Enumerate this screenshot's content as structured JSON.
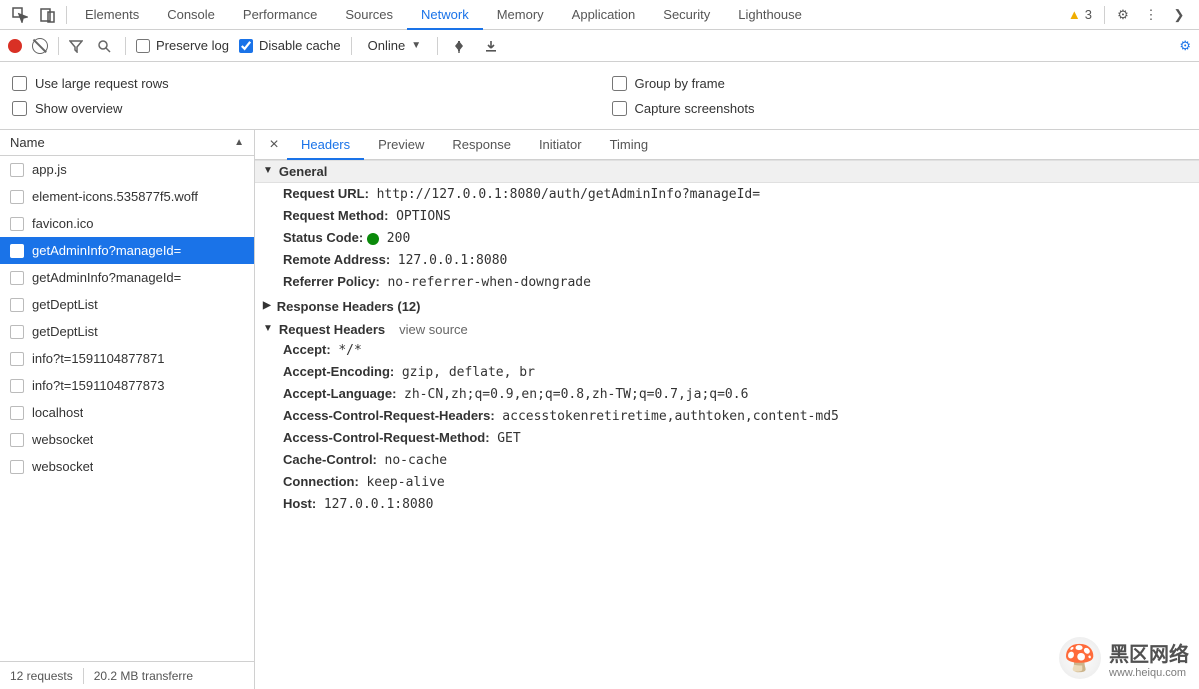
{
  "topTabs": {
    "items": [
      "Elements",
      "Console",
      "Performance",
      "Sources",
      "Network",
      "Memory",
      "Application",
      "Security",
      "Lighthouse"
    ],
    "active": "Network",
    "warnCount": "3"
  },
  "toolbar": {
    "preserveLog": "Preserve log",
    "disableCache": "Disable cache",
    "throttle": "Online"
  },
  "opts": {
    "largeRows": "Use large request rows",
    "overview": "Show overview",
    "groupFrame": "Group by frame",
    "capture": "Capture screenshots"
  },
  "side": {
    "header": "Name",
    "items": [
      "app.js",
      "element-icons.535877f5.woff",
      "favicon.ico",
      "getAdminInfo?manageId=",
      "getAdminInfo?manageId=",
      "getDeptList",
      "getDeptList",
      "info?t=1591104877871",
      "info?t=1591104877873",
      "localhost",
      "websocket",
      "websocket"
    ],
    "selectedIndex": 3,
    "footer": {
      "requests": "12 requests",
      "transferred": "20.2 MB transferre"
    }
  },
  "detail": {
    "tabs": [
      "Headers",
      "Preview",
      "Response",
      "Initiator",
      "Timing"
    ],
    "active": "Headers",
    "sections": {
      "general": {
        "title": "General",
        "rows": [
          {
            "k": "Request URL:",
            "v": "http://127.0.0.1:8080/auth/getAdminInfo?manageId="
          },
          {
            "k": "Request Method:",
            "v": "OPTIONS"
          },
          {
            "k": "Status Code:",
            "v": "200",
            "status": true
          },
          {
            "k": "Remote Address:",
            "v": "127.0.0.1:8080"
          },
          {
            "k": "Referrer Policy:",
            "v": "no-referrer-when-downgrade"
          }
        ]
      },
      "response": {
        "title": "Response Headers (12)"
      },
      "request": {
        "title": "Request Headers",
        "aux": "view source",
        "rows": [
          {
            "k": "Accept:",
            "v": "*/*"
          },
          {
            "k": "Accept-Encoding:",
            "v": "gzip, deflate, br"
          },
          {
            "k": "Accept-Language:",
            "v": "zh-CN,zh;q=0.9,en;q=0.8,zh-TW;q=0.7,ja;q=0.6"
          },
          {
            "k": "Access-Control-Request-Headers:",
            "v": "accesstokenretiretime,authtoken,content-md5"
          },
          {
            "k": "Access-Control-Request-Method:",
            "v": "GET"
          },
          {
            "k": "Cache-Control:",
            "v": "no-cache"
          },
          {
            "k": "Connection:",
            "v": "keep-alive"
          },
          {
            "k": "Host:",
            "v": "127.0.0.1:8080"
          }
        ]
      }
    }
  },
  "watermark": {
    "big": "黑区网络",
    "small": "www.heiqu.com"
  }
}
